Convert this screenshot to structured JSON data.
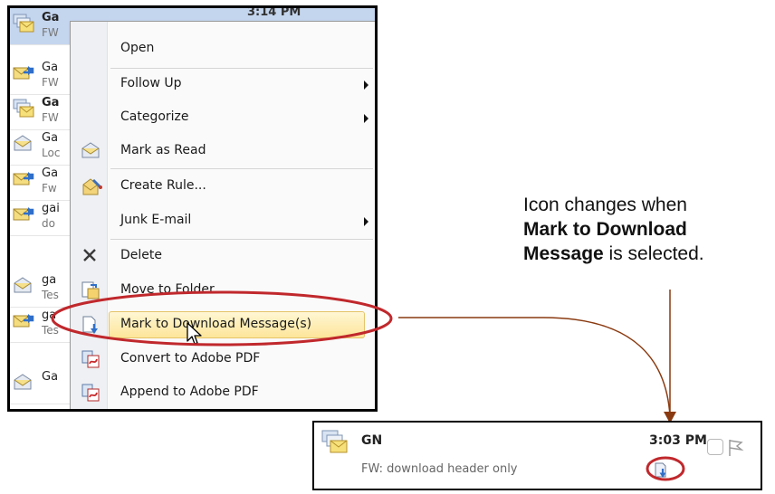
{
  "mail_list": {
    "rows": [
      {
        "sender": "Ga",
        "subject": "FW",
        "bold": true,
        "selected": true,
        "icon": "envelope-stack-icon"
      },
      {
        "sender": "Ga",
        "subject": "FW",
        "bold": false,
        "selected": false,
        "icon": "envelope-forward-icon"
      },
      {
        "sender": "Ga",
        "subject": "FW",
        "bold": true,
        "selected": false,
        "icon": "envelope-stack-icon"
      },
      {
        "sender": "Ga",
        "subject": "Loc",
        "bold": false,
        "selected": false,
        "icon": "envelope-open-icon"
      },
      {
        "sender": "Ga",
        "subject": "Fw",
        "bold": false,
        "selected": false,
        "icon": "envelope-forward-icon"
      },
      {
        "sender": "gai",
        "subject": "do",
        "bold": false,
        "selected": false,
        "icon": "envelope-forward-icon"
      },
      {
        "sender": "ga",
        "subject": "Tes",
        "bold": false,
        "selected": false,
        "icon": "envelope-open-icon"
      },
      {
        "sender": "Ga",
        "subject": "",
        "bold": false,
        "selected": false,
        "icon": "envelope-open-icon"
      }
    ],
    "selected_row_time_fragment": "3:14 PM"
  },
  "context_menu": {
    "items": [
      {
        "label": "Open",
        "has_submenu": false,
        "icon": ""
      },
      {
        "label": "Follow Up",
        "has_submenu": true,
        "icon": ""
      },
      {
        "label": "Categorize",
        "has_submenu": true,
        "icon": ""
      },
      {
        "label": "Mark as Read",
        "has_submenu": false,
        "icon": "envelope-open-icon"
      },
      {
        "label": "Create Rule...",
        "has_submenu": false,
        "icon": "rule-wizard-icon"
      },
      {
        "label": "Junk E-mail",
        "has_submenu": true,
        "icon": ""
      },
      {
        "label": "Delete",
        "has_submenu": false,
        "icon": "delete-x-icon"
      },
      {
        "label": "Move to Folder...",
        "has_submenu": false,
        "icon": "move-folder-icon"
      },
      {
        "label": "Mark to Download Message(s)",
        "has_submenu": false,
        "icon": "download-mark-icon",
        "highlighted": true
      },
      {
        "label": "Convert to Adobe PDF",
        "has_submenu": false,
        "icon": "pdf-convert-icon"
      },
      {
        "label": "Append to Adobe PDF",
        "has_submenu": false,
        "icon": "pdf-append-icon"
      }
    ]
  },
  "callout": {
    "line1": "Icon changes when",
    "bold_text": "Mark to Download Message",
    "bold_line1": "Mark to Download",
    "bold_line2": "Message",
    "line3_rest": " is selected."
  },
  "result_preview": {
    "sender": "GN",
    "time": "3:03 PM",
    "subject": "FW: download header only",
    "icon": "download-marked-icon"
  },
  "colors": {
    "highlight_ring": "#c0282c",
    "connector_line": "#8a3a10",
    "selected_row": "#c4d5ee",
    "menu_highlight": "#fde59a"
  }
}
